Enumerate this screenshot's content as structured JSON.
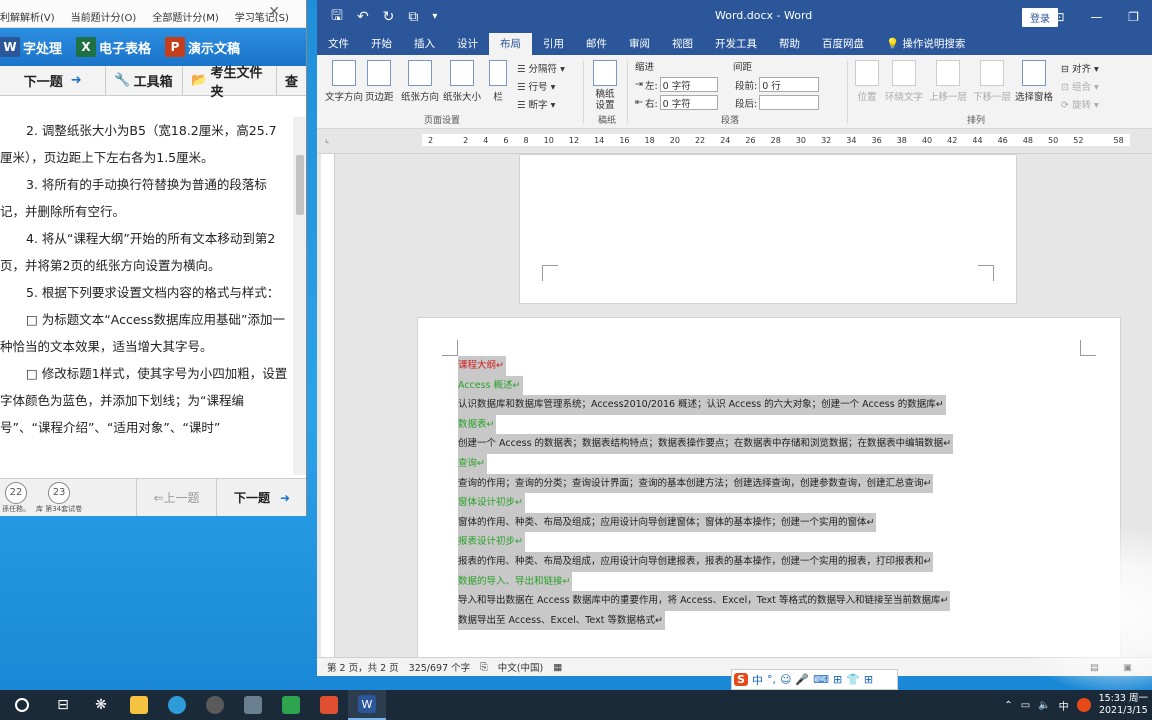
{
  "panel": {
    "menu": [
      "利解解析(V)",
      "当前题计分(O)",
      "全部题计分(M)",
      "学习笔记(S)"
    ],
    "apps": [
      {
        "name": "字处理",
        "icon_letter": "W",
        "icon_color": "#2b579a"
      },
      {
        "name": "电子表格",
        "icon_letter": "X",
        "icon_color": "#1e7145"
      },
      {
        "name": "演示文稿",
        "icon_letter": "P",
        "icon_color": "#c43e1c"
      }
    ],
    "toolbar": {
      "next": "下一题",
      "tools": "工具箱",
      "exam_folder": "考生文件夹",
      "more": "查"
    },
    "instructions": [
      "2. 调整纸张大小为B5（宽18.2厘米，高25.7厘米），页边距上下左右各为1.5厘米。",
      "3. 将所有的手动换行符替换为普通的段落标记，并删除所有空行。",
      "4. 将从“课程大纲”开始的所有文本移动到第2页，并将第2页的纸张方向设置为横向。",
      "5. 根据下列要求设置文档内容的格式与样式：",
      "□ 为标题文本“Access数据库应用基础”添加一种恰当的文本效果，适当增大其字号。",
      "□ 修改标题1样式，使其字号为小四加粗，设置字体颜色为蓝色，并添加下划线；为“课程编号”、“课程介绍”、“适用对象”、“课时”"
    ],
    "bottom": {
      "page_a": "22",
      "page_b": "23",
      "label_a": "孫任務。",
      "label_b": "库 第34套试卷",
      "prev": "上一题",
      "next": "下一题"
    }
  },
  "word": {
    "title": "Word.docx  -  Word",
    "signin": "登录",
    "tabs": [
      "文件",
      "开始",
      "插入",
      "设计",
      "布局",
      "引用",
      "邮件",
      "审阅",
      "视图",
      "开发工具",
      "帮助",
      "百度网盘",
      "操作说明搜索"
    ],
    "active_tab": "布局",
    "ribbon": {
      "page_setup": [
        "文字方向",
        "页边距",
        "纸张方向",
        "纸张大小",
        "栏"
      ],
      "page_setup_small": [
        "分隔符",
        "行号",
        "断字"
      ],
      "page_setup_label": "页面设置",
      "draft": "稿纸设置",
      "draft_label": "稿纸",
      "indent_header": "缩进",
      "spacing_header": "间距",
      "indent_left_label": "左:",
      "indent_left_value": "0 字符",
      "indent_right_label": "右:",
      "indent_right_value": "0 字符",
      "spacing_before_label": "段前:",
      "spacing_before_value": "0 行",
      "spacing_after_label": "段后:",
      "spacing_after_value": "",
      "paragraph_label": "段落",
      "arrange": [
        "位置",
        "环绕文字",
        "上移一层",
        "下移一层",
        "选择窗格"
      ],
      "arrange_small": [
        "对齐",
        "组合",
        "旋转"
      ],
      "arrange_label": "排列"
    },
    "ruler_ticks": [
      "2",
      "",
      "2",
      "4",
      "6",
      "8",
      "10",
      "12",
      "14",
      "16",
      "18",
      "20",
      "22",
      "24",
      "26",
      "28",
      "30",
      "32",
      "34",
      "36",
      "38",
      "40",
      "42",
      "44",
      "46",
      "48",
      "50",
      "52",
      "",
      "58"
    ],
    "document_lines": [
      {
        "text": "课程大纲",
        "color": "red"
      },
      {
        "text": "Access 概述",
        "color": "green"
      },
      {
        "text": "认识数据库和数据库管理系统；Access2010/2016 概述；认识 Access 的六大对象；创建一个 Access 的数据库",
        "color": "black"
      },
      {
        "text": "数据表",
        "color": "green"
      },
      {
        "text": "创建一个 Access 的数据表；数据表结构特点；数据表操作要点；在数据表中存储和浏览数据；在数据表中编辑数据",
        "color": "black"
      },
      {
        "text": "查询",
        "color": "green"
      },
      {
        "text": "查询的作用；查询的分类；查询设计界面；查询的基本创建方法；创建选择查询，创建参数查询，创建汇总查询",
        "color": "black"
      },
      {
        "text": "窗体设计初步",
        "color": "green"
      },
      {
        "text": "窗体的作用、种类、布局及组成；应用设计向导创建窗体；窗体的基本操作；创建一个实用的窗体",
        "color": "black"
      },
      {
        "text": "报表设计初步",
        "color": "green"
      },
      {
        "text": "报表的作用、种类、布局及组成，应用设计向导创建报表，报表的基本操作，创建一个实用的报表，打印报表和",
        "color": "black"
      },
      {
        "text": "数据的导入、导出和链接",
        "color": "green"
      },
      {
        "text": "导入和导出数据在 Access 数据库中的重要作用，将 Access、Excel，Text 等格式的数据导入和链接至当前数据库",
        "color": "black"
      },
      {
        "text": "数据导出至 Access、Excel、Text 等数据格式",
        "color": "black"
      }
    ],
    "status": {
      "page": "第 2 页，共 2 页",
      "words": "325/697 个字",
      "lang": "中文(中国)"
    }
  },
  "ime": {
    "items": [
      "S",
      "中",
      "°,",
      "☺",
      "🎤",
      "⌨",
      "⊞",
      "👕",
      "⊞"
    ]
  },
  "taskbar": {
    "clock_time": "15:33 周一",
    "clock_date": "2021/3/15",
    "tray_lang": "中",
    "apps": [
      {
        "name": "cortana",
        "color": "#ffffff"
      },
      {
        "name": "task-view",
        "color": "#ffffff"
      },
      {
        "name": "app-s",
        "color": "#ffffff"
      },
      {
        "name": "file-explorer",
        "color": "#f5c242"
      },
      {
        "name": "edge",
        "color": "#2d9bd8"
      },
      {
        "name": "app-dark",
        "color": "#5a5a5a"
      },
      {
        "name": "app-pen",
        "color": "#6a7f8f"
      },
      {
        "name": "app-green",
        "color": "#2ea44f"
      },
      {
        "name": "app-red",
        "color": "#e05030"
      },
      {
        "name": "word",
        "color": "#2b579a"
      }
    ]
  }
}
